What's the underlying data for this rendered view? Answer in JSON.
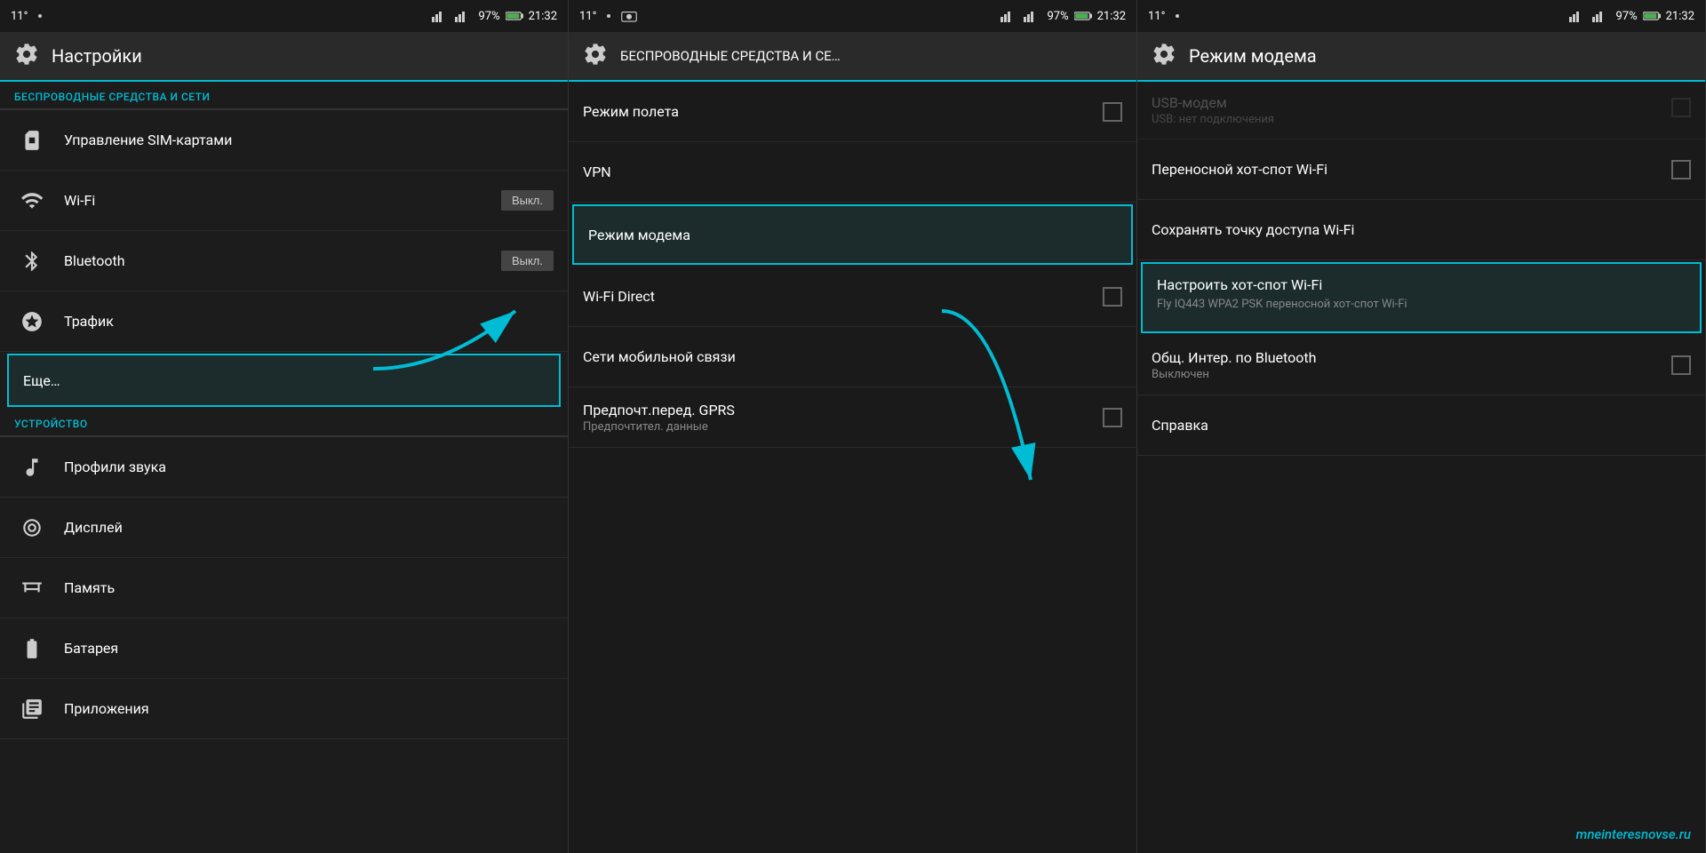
{
  "panel1": {
    "statusBar": {
      "temp": "11°",
      "battery": "97%",
      "time": "21:32"
    },
    "actionBar": {
      "title": "Настройки"
    },
    "sections": [
      {
        "header": "БЕСПРОВОДНЫЕ СРЕДСТВА И СЕТИ",
        "items": [
          {
            "id": "sim",
            "icon": "sim-icon",
            "title": "Управление SIM-картами",
            "toggle": null
          },
          {
            "id": "wifi",
            "icon": "wifi-icon",
            "title": "Wi-Fi",
            "toggle": "Выкл."
          },
          {
            "id": "bluetooth",
            "icon": "bluetooth-icon",
            "title": "Bluetooth",
            "toggle": "Выкл."
          },
          {
            "id": "traffic",
            "icon": "traffic-icon",
            "title": "Трафик",
            "toggle": null
          },
          {
            "id": "more",
            "icon": null,
            "title": "Еще…",
            "toggle": null,
            "highlighted": true
          }
        ]
      },
      {
        "header": "УСТРОЙСТВО",
        "items": [
          {
            "id": "sound",
            "icon": "sound-icon",
            "title": "Профили звука",
            "toggle": null
          },
          {
            "id": "display",
            "icon": "display-icon",
            "title": "Дисплей",
            "toggle": null
          },
          {
            "id": "memory",
            "icon": "memory-icon",
            "title": "Память",
            "toggle": null
          },
          {
            "id": "battery",
            "icon": "battery-icon",
            "title": "Батарея",
            "toggle": null
          },
          {
            "id": "apps",
            "icon": "apps-icon",
            "title": "Приложения",
            "toggle": null
          }
        ]
      }
    ]
  },
  "panel2": {
    "statusBar": {
      "temp": "11°",
      "battery": "97%",
      "time": "21:32"
    },
    "actionBar": {
      "title": "БЕСПРОВОДНЫЕ СРЕДСТВА И СЕ…"
    },
    "items": [
      {
        "id": "airplane",
        "title": "Режим полета",
        "checkbox": false,
        "subtitle": null,
        "highlighted": false
      },
      {
        "id": "vpn",
        "title": "VPN",
        "checkbox": false,
        "subtitle": null,
        "highlighted": false
      },
      {
        "id": "modem",
        "title": "Режим модема",
        "checkbox": false,
        "subtitle": null,
        "highlighted": true
      },
      {
        "id": "wifidirect",
        "title": "Wi-Fi Direct",
        "checkbox": false,
        "subtitle": null,
        "highlighted": false
      },
      {
        "id": "mobile",
        "title": "Сети мобильной связи",
        "checkbox": false,
        "subtitle": null,
        "highlighted": false
      },
      {
        "id": "gprs",
        "title": "Предпочт.перед. GPRS",
        "checkbox": false,
        "subtitle": "Предпочтител. данные",
        "highlighted": false
      }
    ]
  },
  "panel3": {
    "statusBar": {
      "temp": "11°",
      "battery": "97%",
      "time": "21:32"
    },
    "actionBar": {
      "title": "Режим модема"
    },
    "items": [
      {
        "id": "usb",
        "title": "USB-модем",
        "subtitle": "USB: нет подключения",
        "checkbox": false,
        "disabled": true
      },
      {
        "id": "hotspot",
        "title": "Переносной хот-спот Wi-Fi",
        "checkbox": false,
        "disabled": false,
        "highlighted": false
      },
      {
        "id": "save",
        "title": "Сохранять точку доступа Wi-Fi",
        "checkbox": false,
        "disabled": false,
        "highlighted": false
      },
      {
        "id": "configure",
        "title": "Настроить хот-спот Wi-Fi",
        "subtitle": "Fly IQ443 WPA2 PSK переносной хот-спот Wi-Fi",
        "checkbox": false,
        "disabled": false,
        "highlighted": true
      },
      {
        "id": "bluetooth-share",
        "title": "Общ. Интер. по Bluetooth",
        "subtitle": "Выключен",
        "checkbox": false,
        "disabled": false,
        "highlighted": false
      },
      {
        "id": "help",
        "title": "Справка",
        "checkbox": false,
        "disabled": false,
        "highlighted": false
      }
    ],
    "watermark": "mneinteresnovse.ru"
  }
}
